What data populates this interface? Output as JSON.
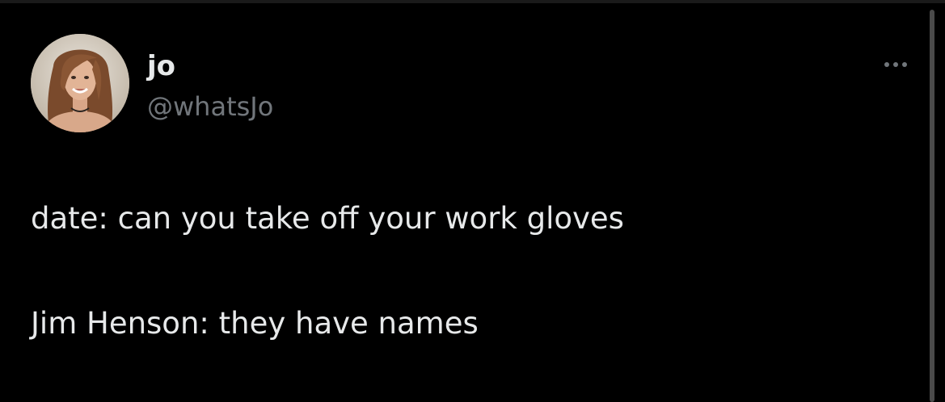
{
  "tweet": {
    "author": {
      "display_name": "jo",
      "handle": "@whatsJo",
      "avatar_icon": "profile-photo"
    },
    "more_icon": "more-horizontal-icon",
    "lines": [
      "date: can you take off your work gloves",
      "Jim Henson: they have names"
    ]
  },
  "colors": {
    "background": "#000000",
    "primary_text": "#e7e9ea",
    "secondary_text": "#71767b"
  }
}
